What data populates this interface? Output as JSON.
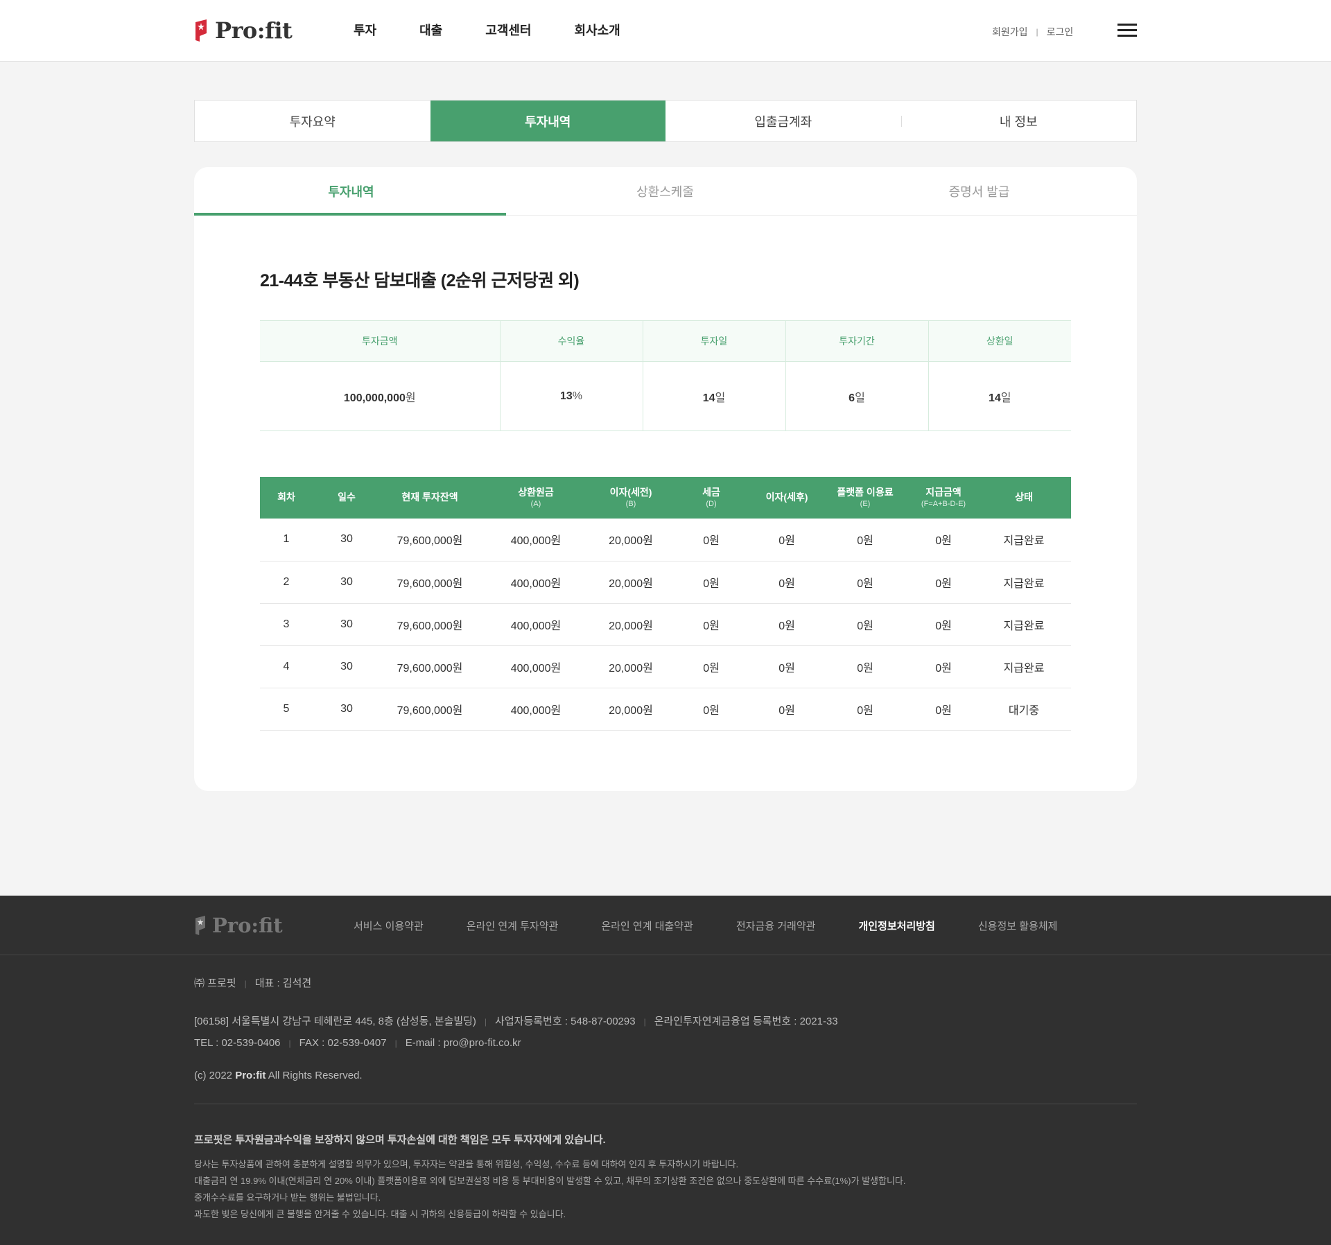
{
  "header": {
    "logo_text": "Pro:fit",
    "nav": [
      "투자",
      "대출",
      "고객센터",
      "회사소개"
    ],
    "util": {
      "signup": "회원가입",
      "login": "로그인"
    }
  },
  "main_tabs": [
    "투자요약",
    "투자내역",
    "입출금계좌",
    "내 정보"
  ],
  "sub_tabs": [
    "투자내역",
    "상환스케줄",
    "증명서 발급"
  ],
  "product": {
    "title": "21-44호 부동산 담보대출 (2순위 근저당권 외)",
    "summary_headers": [
      "투자금액",
      "수익율",
      "투자일",
      "투자기간",
      "상환일"
    ],
    "summary_values": [
      {
        "num": "100,000,000",
        "unit": "원"
      },
      {
        "num": "13",
        "unit": "%"
      },
      {
        "num": "14",
        "unit": "일"
      },
      {
        "num": "6",
        "unit": "일"
      },
      {
        "num": "14",
        "unit": "일"
      }
    ]
  },
  "schedule": {
    "headers": [
      {
        "label": "회차",
        "sub": ""
      },
      {
        "label": "일수",
        "sub": ""
      },
      {
        "label": "현재 투자잔액",
        "sub": ""
      },
      {
        "label": "상환원금",
        "sub": "(A)"
      },
      {
        "label": "이자(세전)",
        "sub": "(B)"
      },
      {
        "label": "세금",
        "sub": "(D)"
      },
      {
        "label": "이자(세후)",
        "sub": ""
      },
      {
        "label": "플랫폼 이용료",
        "sub": "(E)"
      },
      {
        "label": "지급금액",
        "sub": "(F=A+B-D-E)"
      },
      {
        "label": "상태",
        "sub": ""
      }
    ],
    "rows": [
      [
        "1",
        "30",
        "79,600,000원",
        "400,000원",
        "20,000원",
        "0원",
        "0원",
        "0원",
        "0원",
        "지급완료"
      ],
      [
        "2",
        "30",
        "79,600,000원",
        "400,000원",
        "20,000원",
        "0원",
        "0원",
        "0원",
        "0원",
        "지급완료"
      ],
      [
        "3",
        "30",
        "79,600,000원",
        "400,000원",
        "20,000원",
        "0원",
        "0원",
        "0원",
        "0원",
        "지급완료"
      ],
      [
        "4",
        "30",
        "79,600,000원",
        "400,000원",
        "20,000원",
        "0원",
        "0원",
        "0원",
        "0원",
        "지급완료"
      ],
      [
        "5",
        "30",
        "79,600,000원",
        "400,000원",
        "20,000원",
        "0원",
        "0원",
        "0원",
        "0원",
        "대기중"
      ]
    ]
  },
  "footer": {
    "logo_text": "Pro:fit",
    "links": [
      "서비스 이용약관",
      "온라인 연계 투자약관",
      "온라인 연계 대출약관",
      "전자금융 거래약관",
      "개인정보처리방침",
      "신용정보 활용체제"
    ],
    "company": "㈜ 프로핏",
    "ceo": "대표 : 김석견",
    "address": "[06158] 서울특별시 강남구 테헤란로 445, 8층 (삼성동, 본솔빌딩)",
    "biz_no": "사업자등록번호 : 548-87-00293",
    "reg_no": "온라인투자연계금융업 등록번호 : 2021-33",
    "tel": "TEL : 02-539-0406",
    "fax": "FAX : 02-539-0407",
    "email": "E-mail : pro@pro-fit.co.kr",
    "copy_prefix": "(c) 2022 ",
    "copy_brand": "Pro:fit",
    "copy_suffix": " All Rights Reserved.",
    "warning": "프로핏은 투자원금과수익을 보장하지 않으며 투자손실에 대한 책임은 모두 투자자에게 있습니다.",
    "notes": [
      "당사는 투자상품에 관하여 충분하게 설명할 의무가 있으며, 투자자는 약관을 통해 위험성, 수익성, 수수료 등에 대하여 인지 후 투자하시기 바랍니다.",
      "대출금리 연 19.9% 이내(연체금리 연 20% 이내) 플랫폼이용료 외에 담보권설정 비용 등 부대비용이 발생할 수 있고, 채무의 조기상환 조건은 없으나 중도상환에 따른 수수료(1%)가 발생합니다.",
      "중개수수료를 요구하거나 받는 행위는 불법입니다.",
      "과도한 빚은 당신에게 큰 불행을 안겨줄 수 있습니다. 대출 시 귀하의 신용등급이 하락할 수 있습니다."
    ]
  },
  "colors": {
    "accent": "#48a06e",
    "logo_red": "#d42a3a",
    "footer_bg": "#303030"
  }
}
